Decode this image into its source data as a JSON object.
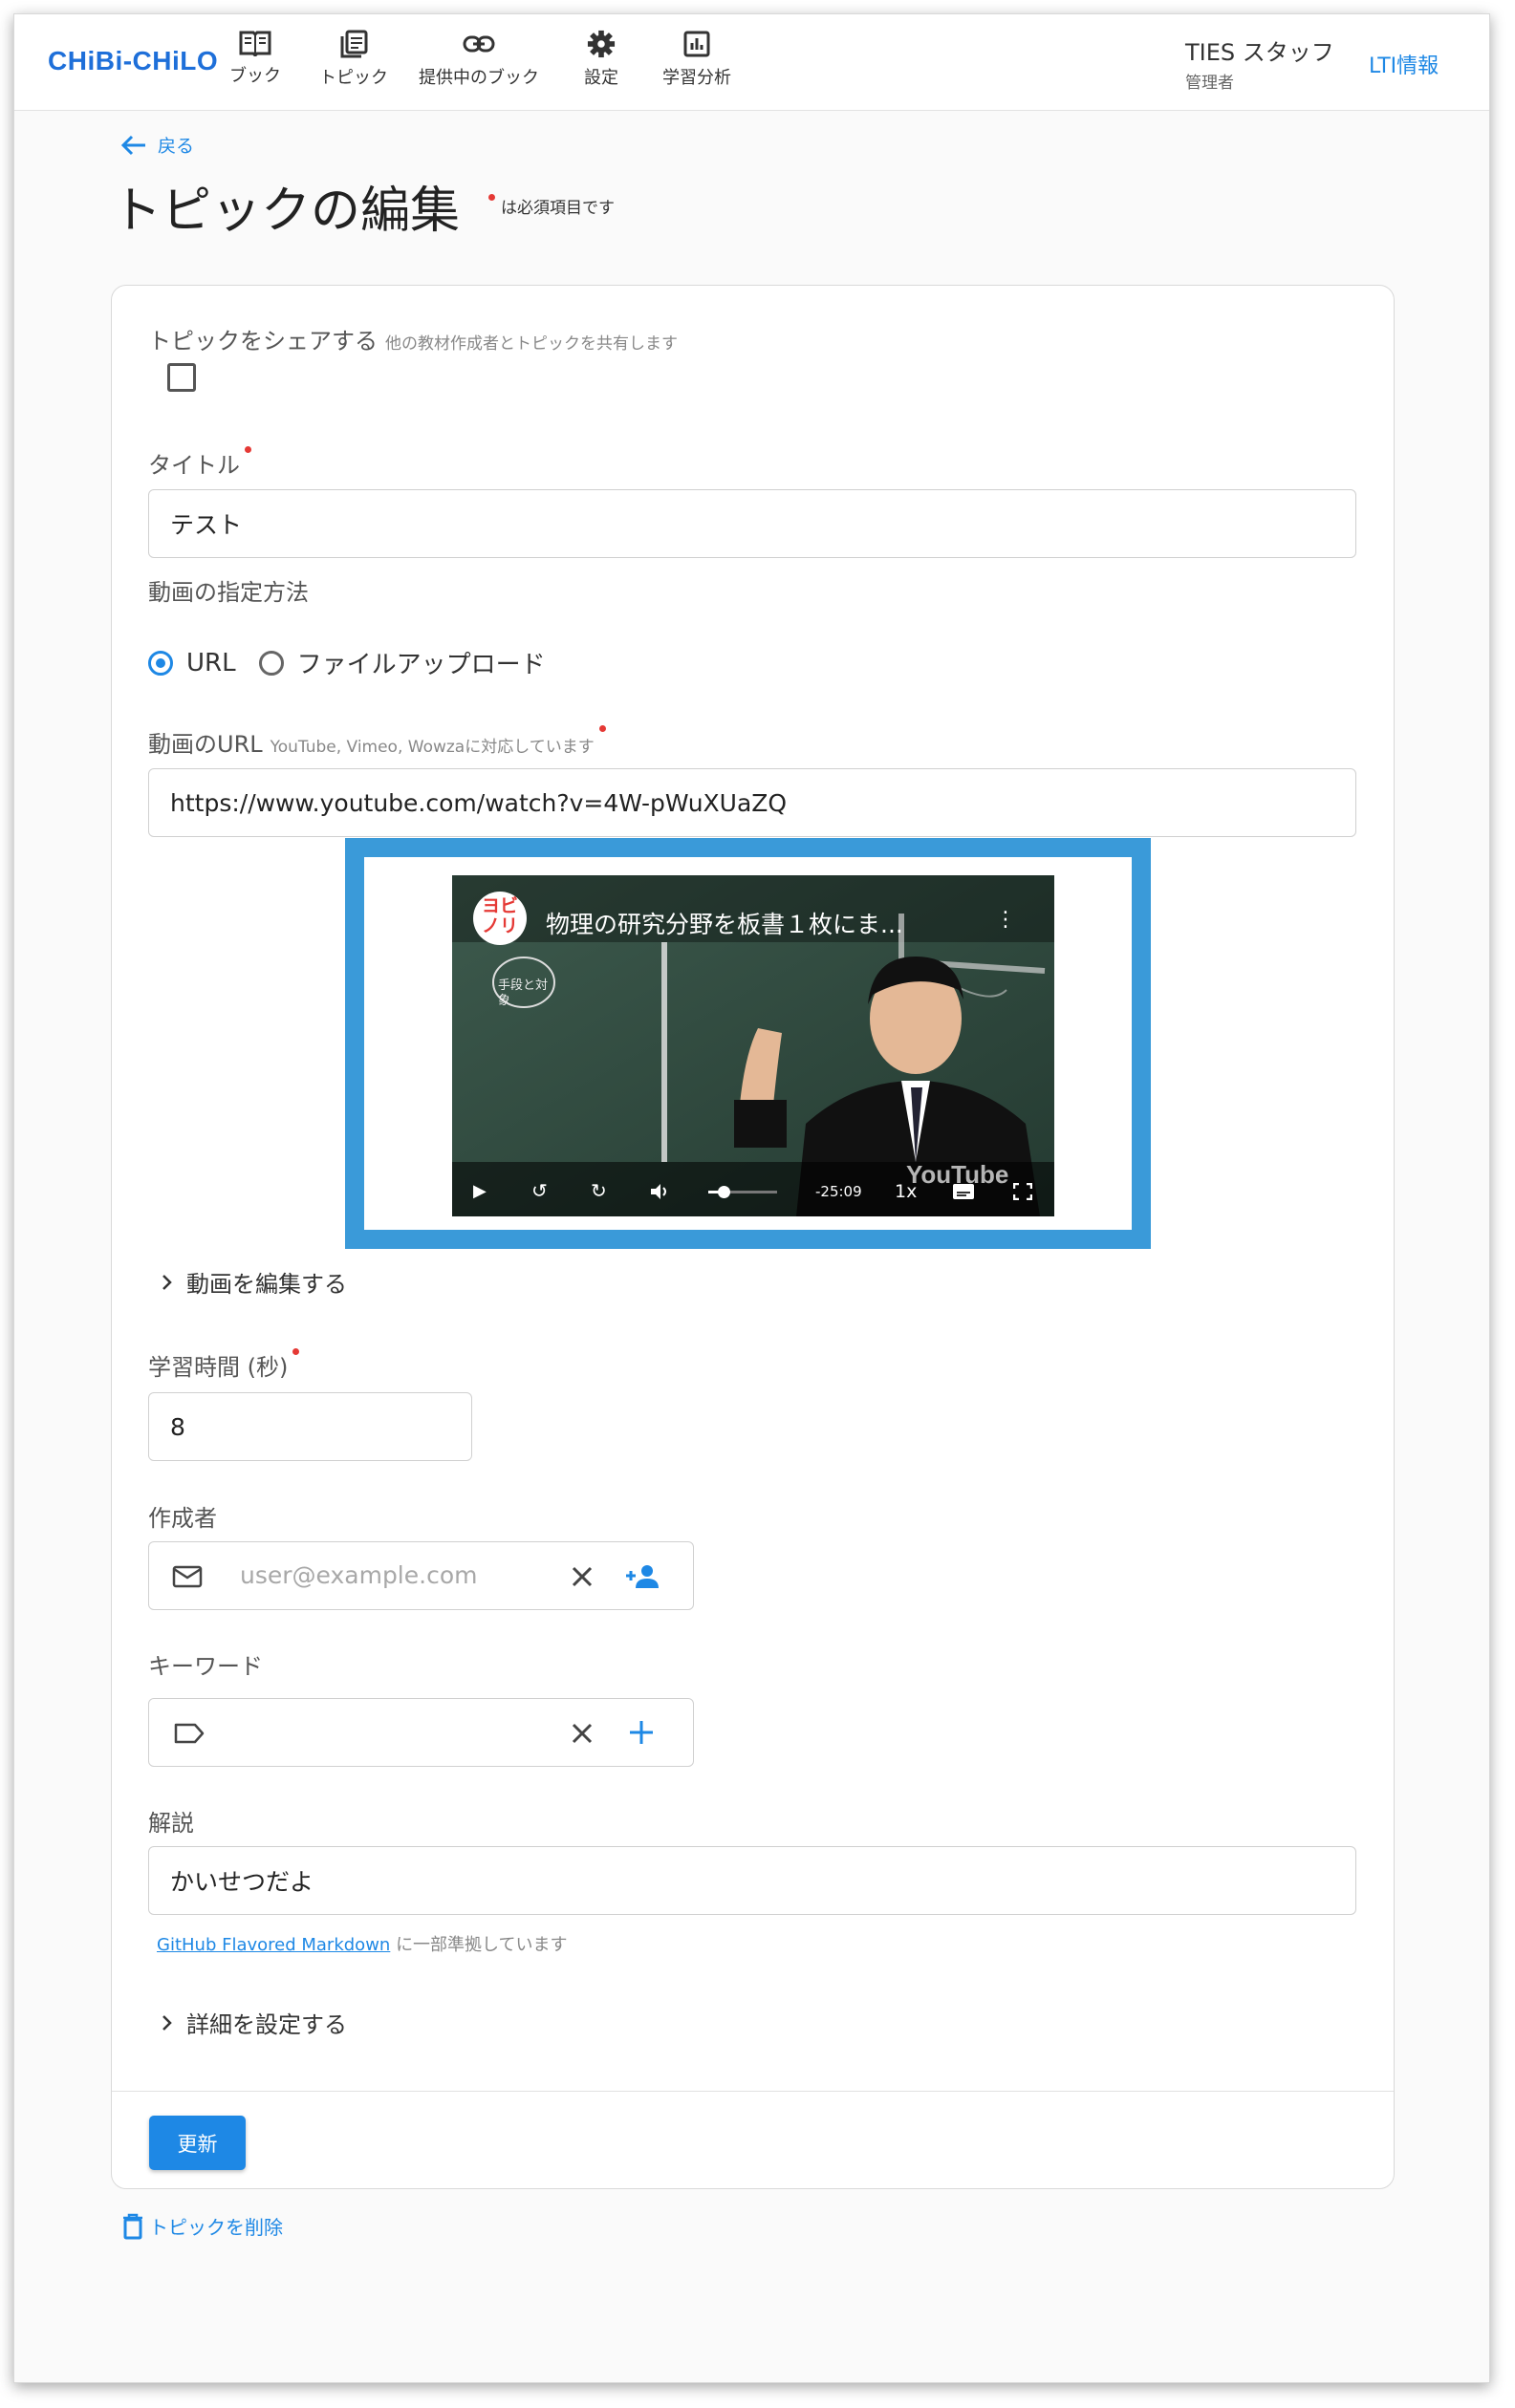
{
  "app": {
    "logo": "CHiBi-CHiLO"
  },
  "nav": [
    {
      "label": "ブック",
      "icon": "book-icon"
    },
    {
      "label": "トピック",
      "icon": "topic-icon"
    },
    {
      "label": "提供中のブック",
      "icon": "link-icon"
    },
    {
      "label": "設定",
      "icon": "gear-icon"
    },
    {
      "label": "学習分析",
      "icon": "analytics-icon"
    }
  ],
  "user": {
    "name": "TIES スタッフ",
    "role": "管理者"
  },
  "lti_link": "LTI情報",
  "back_label": "戻る",
  "page_title": "トピックの編集",
  "required_note": "は必須項目です",
  "form": {
    "share": {
      "label": "トピックをシェアする",
      "hint": "他の教材作成者とトピックを共有します",
      "checked": false
    },
    "title": {
      "label": "タイトル",
      "value": "テスト"
    },
    "video_method": {
      "label": "動画の指定方法",
      "options": [
        "URL",
        "ファイルアップロード"
      ],
      "selected": "URL"
    },
    "video_url": {
      "label": "動画のURL",
      "hint": "YouTube, Vimeo, Wowzaに対応しています",
      "value": "https://www.youtube.com/watch?v=4W-pWuXUaZQ"
    },
    "video": {
      "title": "物理の研究分野を板書１枚にま...",
      "remaining": "-25:09",
      "speed": "1x",
      "watermark": "YouTube",
      "channel_badge": "ヨビノリ",
      "board_note": "手段と対象"
    },
    "edit_video_label": "動画を編集する",
    "duration": {
      "label": "学習時間 (秒)",
      "value": "8"
    },
    "author": {
      "label": "作成者",
      "placeholder": "user@example.com"
    },
    "keywords": {
      "label": "キーワード",
      "placeholder": ""
    },
    "description": {
      "label": "解説",
      "value": "かいせつだよ"
    },
    "markdown_link": "GitHub Flavored Markdown",
    "markdown_note": "に一部準拠しています",
    "advanced_label": "詳細を設定する",
    "submit_label": "更新"
  },
  "delete_label": "トピックを削除",
  "colors": {
    "accent": "#1e88e5",
    "required": "#e53935",
    "video_border": "#3a9ad9"
  }
}
